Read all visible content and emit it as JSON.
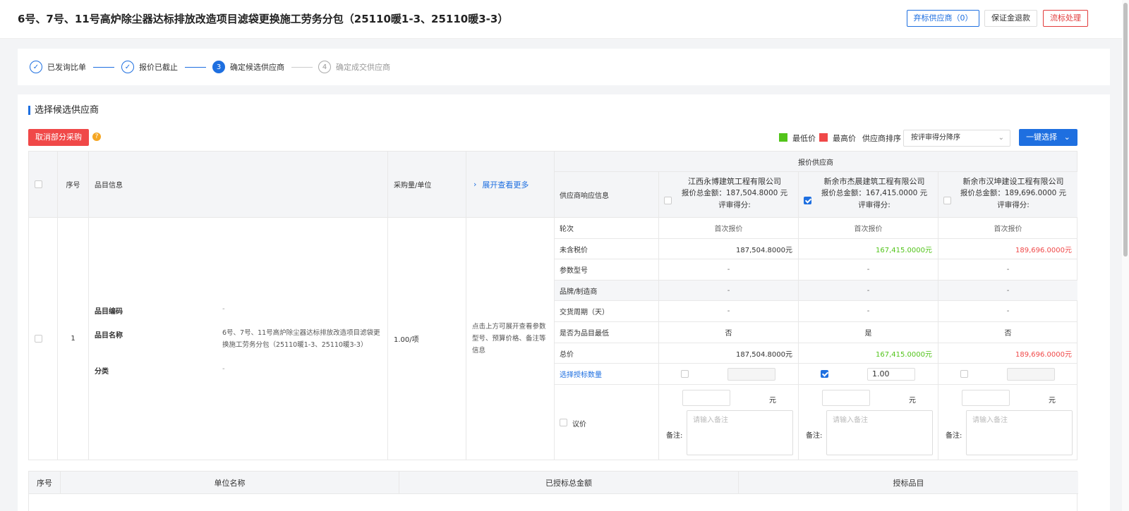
{
  "header": {
    "title": "6号、7号、11号高炉除尘器达标排放改造项目滤袋更换施工劳务分包（25110暖1-3、25110暖3-3）",
    "btn_abandon": "弃标供应商（0）",
    "btn_deposit": "保证金退款",
    "btn_fail": "流标处理"
  },
  "steps": [
    {
      "label": "已发询比单",
      "num": "",
      "state": "done"
    },
    {
      "label": "报价已截止",
      "num": "",
      "state": "done"
    },
    {
      "label": "确定候选供应商",
      "num": "3",
      "state": "active"
    },
    {
      "label": "确定成交供应商",
      "num": "4",
      "state": "todo"
    }
  ],
  "section": {
    "title": "选择候选供应商",
    "cancel_partial": "取消部分采购",
    "help": "?",
    "legend_low": "最低价",
    "legend_high": "最高价",
    "sort_label": "供应商排序",
    "sort_value": "按评审得分降序",
    "one_click": "一键选择"
  },
  "colors": {
    "accent": "#1e6fe0",
    "low": "#52c41a",
    "high": "#f04848"
  },
  "table": {
    "h_seq": "序号",
    "h_item": "品目信息",
    "h_qty": "采购量/单位",
    "h_expand": "展开查看更多",
    "h_quote_suppliers": "报价供应商",
    "h_resp_info": "供应商响应信息",
    "suppliers": [
      {
        "name": "江西永博建筑工程有限公司",
        "total": "报价总金额：187,504.8000 元",
        "score": "评审得分:",
        "checked": false
      },
      {
        "name": "新余市杰晨建筑工程有限公司",
        "total": "报价总金额：167,415.0000 元",
        "score": "评审得分:",
        "checked": true
      },
      {
        "name": "新余市汉坤建设工程有限公司",
        "total": "报价总金额：189,696.0000 元",
        "score": "评审得分:",
        "checked": false
      }
    ],
    "row": {
      "seq": "1",
      "code_label": "品目编码",
      "code_value": "-",
      "name_label": "品目名称",
      "name_value": "6号、7号、11号高炉除尘器达标排放改造项目滤袋更换施工劳务分包（25110暖1-3、25110暖3-3）",
      "cat_label": "分类",
      "cat_value": "-",
      "qty": "1.00/项",
      "expand_hint": "点击上方可展开查看参数型号、预算价格、备注等信息"
    },
    "resp_rows": [
      {
        "label": "轮次",
        "values": [
          "首次报价",
          "首次报价",
          "首次报价"
        ],
        "align": "center"
      },
      {
        "label": "未含税价",
        "values": [
          "187,504.8000元",
          "167,415.0000元",
          "189,696.0000元"
        ],
        "align": "right"
      },
      {
        "label": "参数型号",
        "values": [
          "-",
          "-",
          "-"
        ],
        "align": "center"
      },
      {
        "label": "品牌/制造商",
        "values": [
          "-",
          "-",
          "-"
        ],
        "align": "center"
      },
      {
        "label": "交货周期（天）",
        "values": [
          "-",
          "-",
          "-"
        ],
        "align": "center"
      },
      {
        "label": "是否为品目最低",
        "values": [
          "否",
          "是",
          "否"
        ],
        "align": "center"
      },
      {
        "label": "总价",
        "values": [
          "187,504.8000元",
          "167,415.0000元",
          "189,696.0000元"
        ],
        "align": "right"
      }
    ],
    "select_qty_label": "选择授标数量",
    "select_qty_values": [
      "",
      "1.00",
      ""
    ],
    "negotiate_label": "议价",
    "yuan": "元",
    "remark_label": "备注:",
    "remark_placeholder": "请输入备注"
  },
  "award_table": {
    "h_seq": "序号",
    "h_unit": "单位名称",
    "h_amount": "已授标总金额",
    "h_items": "授标品目"
  }
}
